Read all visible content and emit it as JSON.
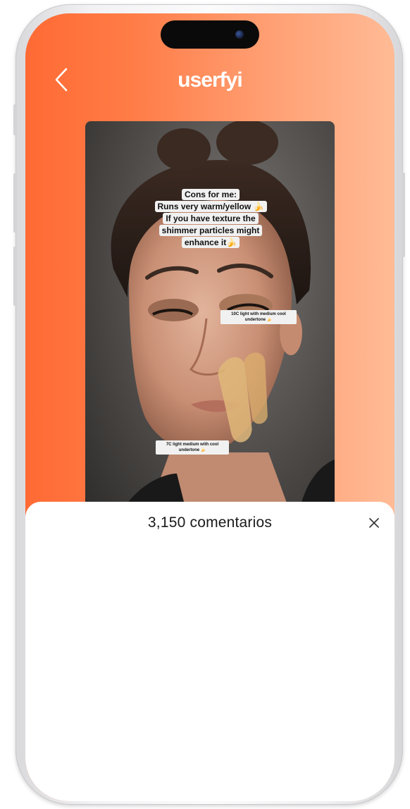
{
  "app": {
    "brand": "userfyi"
  },
  "video": {
    "caption_lines": [
      "Cons for me:",
      "Runs very warm/yellow 🍌",
      "If you have texture the",
      "shimmer particles might",
      "enhance it🍌"
    ],
    "swatch_tags": [
      "10C light with medium cool undertone 🍌",
      "7C light medium with cool undertone 🍌"
    ]
  },
  "comments": {
    "title": "3,150 comentarios"
  },
  "icons": {
    "back": "chevron-left-icon",
    "close": "close-icon"
  },
  "colors": {
    "accent_start": "#ff6a34",
    "accent_end": "#ffbb96"
  }
}
